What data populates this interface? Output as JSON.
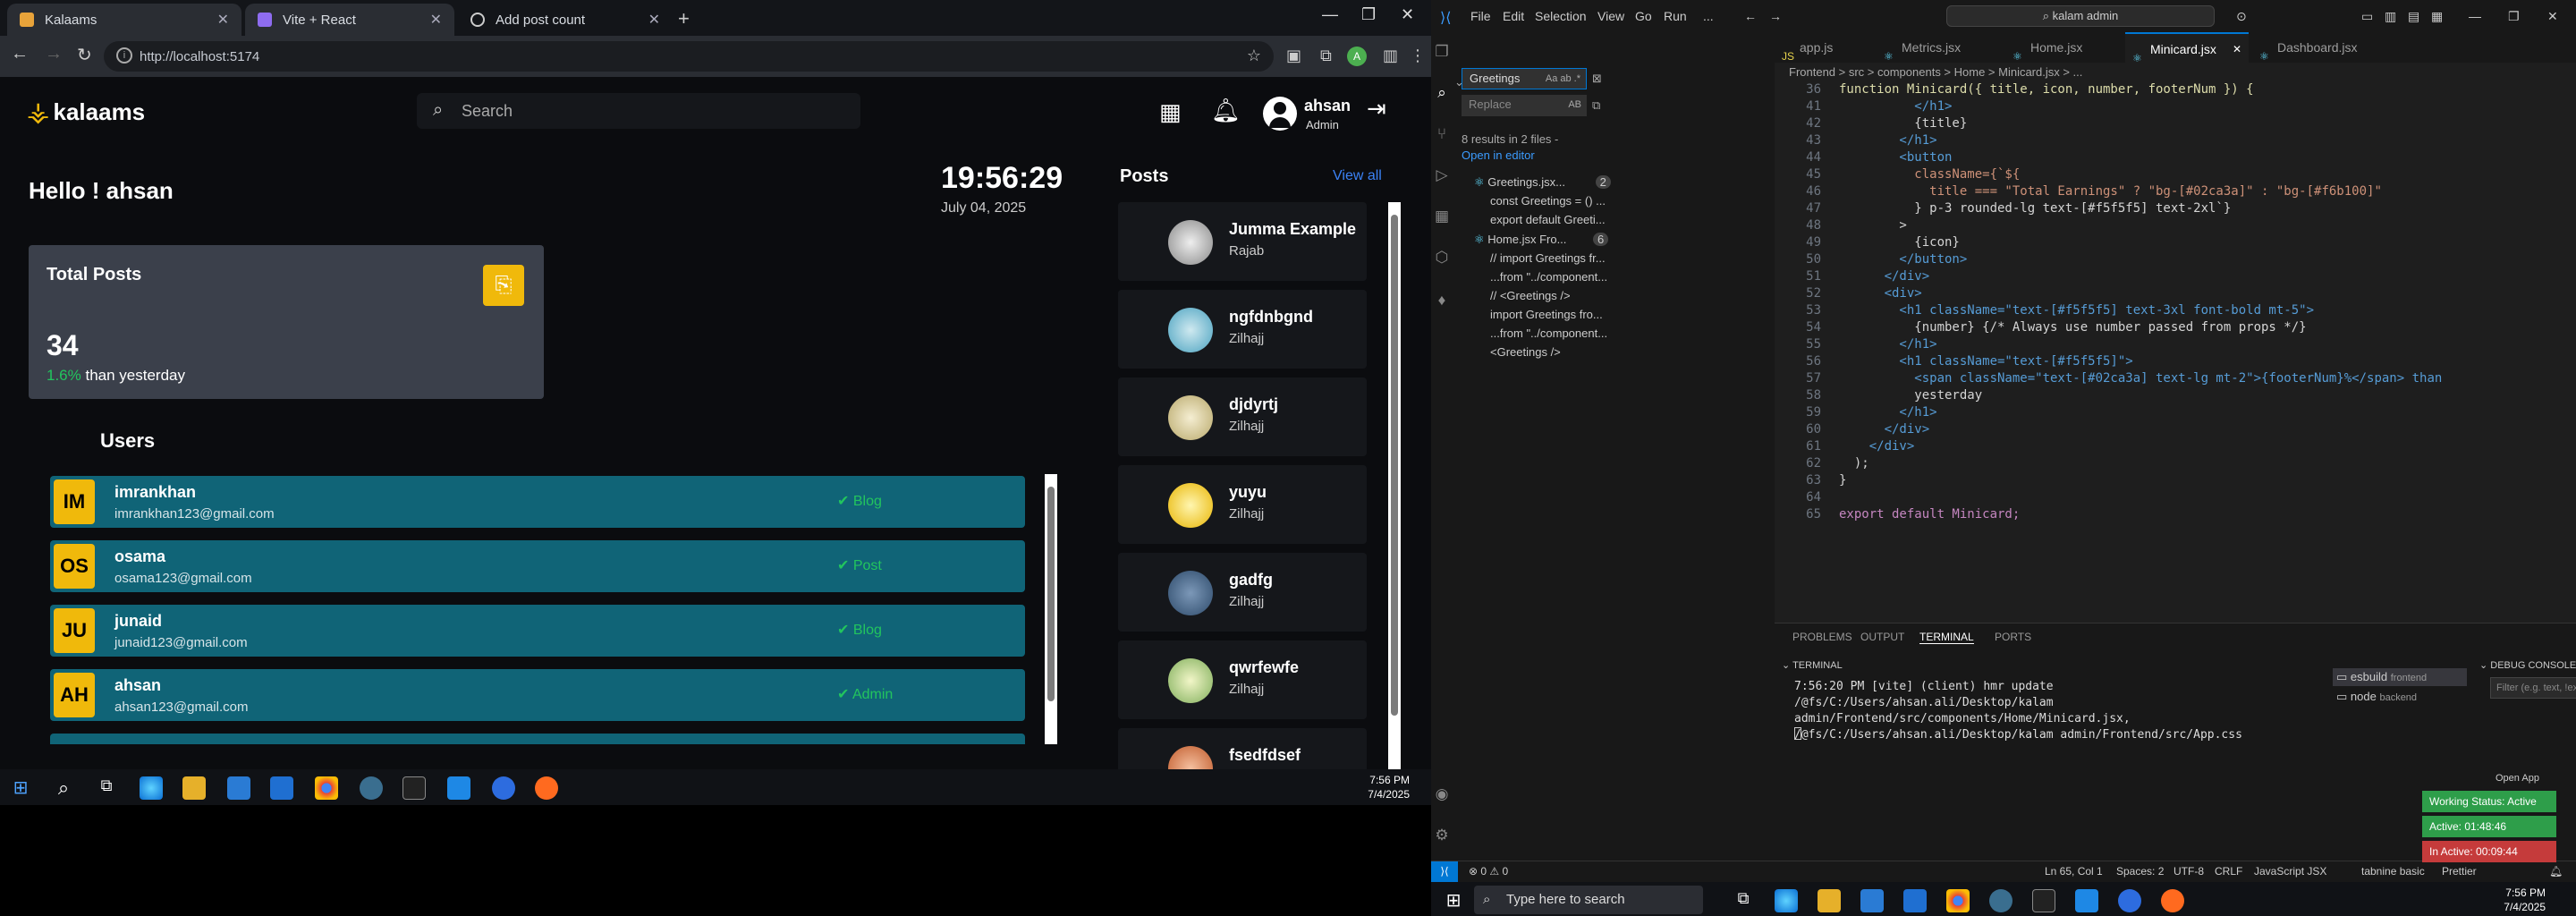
{
  "chrome": {
    "tabs": [
      {
        "title": "Kalaams",
        "fav": "#e8a33a"
      },
      {
        "title": "Vite + React",
        "fav": "#8e6cf0"
      },
      {
        "title": "Add post count",
        "fav": "#cccccc"
      }
    ],
    "url": "http://localhost:5174"
  },
  "app": {
    "logo": "kalaams",
    "search_placeholder": "Search",
    "user": {
      "name": "ahsan",
      "role": "Admin"
    },
    "greeting": "Hello ! ahsan",
    "time": "19:56:29",
    "date": "July 04, 2025",
    "card": {
      "title": "Total Posts",
      "value": "34",
      "change": "1.6%",
      "change_suffix": " than yesterday"
    },
    "users_title": "Users",
    "users": [
      {
        "initials": "IM",
        "name": "imrankhan",
        "email": "imrankhan123@gmail.com",
        "role": "Blog"
      },
      {
        "initials": "OS",
        "name": "osama",
        "email": "osama123@gmail.com",
        "role": "Post"
      },
      {
        "initials": "JU",
        "name": "junaid",
        "email": "junaid123@gmail.com",
        "role": "Blog"
      },
      {
        "initials": "AH",
        "name": "ahsan",
        "email": "ahsan123@gmail.com",
        "role": "Admin"
      }
    ],
    "posts_title": "Posts",
    "view_all": "View all",
    "posts": [
      {
        "title": "Jumma Example",
        "author": "Rajab"
      },
      {
        "title": "ngfdnbgnd",
        "author": "Zilhajj"
      },
      {
        "title": "djdyrtj",
        "author": "Zilhajj"
      },
      {
        "title": "yuyu",
        "author": "Zilhajj"
      },
      {
        "title": "gadfg",
        "author": "Zilhajj"
      },
      {
        "title": "qwrfewfe",
        "author": "Zilhajj"
      },
      {
        "title": "fsedfdsef",
        "author": ""
      }
    ]
  },
  "taskbar_left": {
    "time": "7:56 PM",
    "date": "7/4/2025"
  },
  "vscode": {
    "menu": [
      "File",
      "Edit",
      "Selection",
      "View",
      "Go",
      "Run",
      "..."
    ],
    "command_search": "kalam admin",
    "find": "Greetings",
    "replace": "Replace",
    "results_summary": "8 results in 2 files -",
    "open_in_editor": "Open in editor",
    "results": [
      {
        "text": "Greetings.jsx...",
        "count": "2"
      },
      {
        "text": "const Greetings = () ..."
      },
      {
        "text": "export default Greeti..."
      },
      {
        "text": "Home.jsx Fro...",
        "count": "6"
      },
      {
        "text": "// import Greetings fr..."
      },
      {
        "text": "...from \"../component..."
      },
      {
        "text": "// <Greetings />"
      },
      {
        "text": "import Greetings fro..."
      },
      {
        "text": "...from \"../component..."
      },
      {
        "text": "<Greetings />"
      }
    ],
    "tabs": [
      "app.js",
      "Metrics.jsx",
      "Home.jsx",
      "Minicard.jsx",
      "Dashboard.jsx"
    ],
    "breadcrumb": "Frontend > src > components > Home > Minicard.jsx > ...",
    "sticky_line": "function Minicard({ title, icon, number, footerNum }) {",
    "code_lines": [
      {
        "n": "41",
        "t": "          </h1>"
      },
      {
        "n": "42",
        "t": "          {title}"
      },
      {
        "n": "43",
        "t": "        </h1>"
      },
      {
        "n": "44",
        "t": "        <button"
      },
      {
        "n": "45",
        "t": "          className={`${"
      },
      {
        "n": "46",
        "t": "            title === \"Total Earnings\" ? \"bg-[#02ca3a]\" : \"bg-[#f6b100]\""
      },
      {
        "n": "47",
        "t": "          } p-3 rounded-lg text-[#f5f5f5] text-2xl`}"
      },
      {
        "n": "48",
        "t": "        >"
      },
      {
        "n": "49",
        "t": "          {icon}"
      },
      {
        "n": "50",
        "t": "        </button>"
      },
      {
        "n": "51",
        "t": "      </div>"
      },
      {
        "n": "52",
        "t": "      <div>"
      },
      {
        "n": "53",
        "t": "        <h1 className=\"text-[#f5f5f5] text-3xl font-bold mt-5\">"
      },
      {
        "n": "54",
        "t": "          {number} {/* Always use number passed from props */}"
      },
      {
        "n": "55",
        "t": "        </h1>"
      },
      {
        "n": "56",
        "t": "        <h1 className=\"text-[#f5f5f5]\">"
      },
      {
        "n": "57",
        "t": "          <span className=\"text-[#02ca3a] text-lg mt-2\">{footerNum}%</span> than"
      },
      {
        "n": "58",
        "t": "          yesterday"
      },
      {
        "n": "59",
        "t": "        </h1>"
      },
      {
        "n": "60",
        "t": "      </div>"
      },
      {
        "n": "61",
        "t": "    </div>"
      },
      {
        "n": "62",
        "t": "  );"
      },
      {
        "n": "63",
        "t": "}"
      },
      {
        "n": "64",
        "t": ""
      },
      {
        "n": "65",
        "t": "export default Minicard;"
      }
    ],
    "panel_tabs": [
      "PROBLEMS",
      "OUTPUT",
      "TERMINAL",
      "PORTS"
    ],
    "terminal_title": "TERMINAL",
    "terminal_text": "7:56:20 PM [vite] (client) hmr update /@fs/C:/Users/ahsan.ali/Desktop/kalam admin/Frontend/src/components/Home/Minicard.jsx, /@fs/C:/Users/ahsan.ali/Desktop/kalam admin/Frontend/src/App.css",
    "terminal_list": [
      {
        "name": "esbuild",
        "sub": "frontend"
      },
      {
        "name": "node",
        "sub": "backend"
      }
    ],
    "debug_title": "DEBUG CONSOLE",
    "debug_filter": "Filter (e.g. text, !exclude, \\escape)",
    "open_app": "Open App",
    "work_status": [
      {
        "label": "Working Status: Active",
        "color": "#2e9e4a"
      },
      {
        "label": "Active: 01:48:46",
        "color": "#2e9e4a"
      },
      {
        "label": "In Active: 00:09:44",
        "color": "#c53b3b"
      }
    ],
    "status": {
      "errors": "0",
      "warnings": "0",
      "position": "Ln 65, Col 1",
      "spaces": "Spaces: 2",
      "encoding": "UTF-8",
      "eol": "CRLF",
      "language": "JavaScript JSX",
      "tabnine": "tabnine basic",
      "prettier": "Prettier"
    }
  },
  "taskbar_right": {
    "search": "Type here to search",
    "time": "7:56 PM",
    "date": "7/4/2025"
  }
}
